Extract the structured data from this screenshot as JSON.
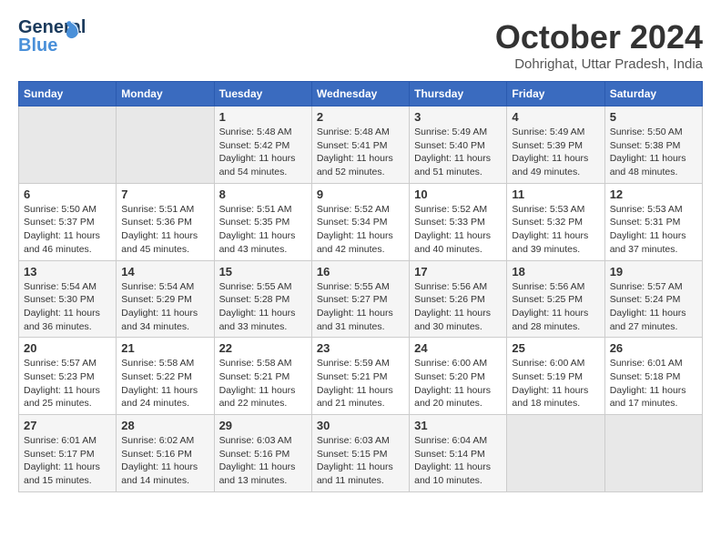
{
  "logo": {
    "line1": "General",
    "line2": "Blue"
  },
  "title": "October 2024",
  "subtitle": "Dohrighat, Uttar Pradesh, India",
  "days_header": [
    "Sunday",
    "Monday",
    "Tuesday",
    "Wednesday",
    "Thursday",
    "Friday",
    "Saturday"
  ],
  "weeks": [
    [
      {
        "day": "",
        "info": ""
      },
      {
        "day": "",
        "info": ""
      },
      {
        "day": "1",
        "info": "Sunrise: 5:48 AM\nSunset: 5:42 PM\nDaylight: 11 hours and 54 minutes."
      },
      {
        "day": "2",
        "info": "Sunrise: 5:48 AM\nSunset: 5:41 PM\nDaylight: 11 hours and 52 minutes."
      },
      {
        "day": "3",
        "info": "Sunrise: 5:49 AM\nSunset: 5:40 PM\nDaylight: 11 hours and 51 minutes."
      },
      {
        "day": "4",
        "info": "Sunrise: 5:49 AM\nSunset: 5:39 PM\nDaylight: 11 hours and 49 minutes."
      },
      {
        "day": "5",
        "info": "Sunrise: 5:50 AM\nSunset: 5:38 PM\nDaylight: 11 hours and 48 minutes."
      }
    ],
    [
      {
        "day": "6",
        "info": "Sunrise: 5:50 AM\nSunset: 5:37 PM\nDaylight: 11 hours and 46 minutes."
      },
      {
        "day": "7",
        "info": "Sunrise: 5:51 AM\nSunset: 5:36 PM\nDaylight: 11 hours and 45 minutes."
      },
      {
        "day": "8",
        "info": "Sunrise: 5:51 AM\nSunset: 5:35 PM\nDaylight: 11 hours and 43 minutes."
      },
      {
        "day": "9",
        "info": "Sunrise: 5:52 AM\nSunset: 5:34 PM\nDaylight: 11 hours and 42 minutes."
      },
      {
        "day": "10",
        "info": "Sunrise: 5:52 AM\nSunset: 5:33 PM\nDaylight: 11 hours and 40 minutes."
      },
      {
        "day": "11",
        "info": "Sunrise: 5:53 AM\nSunset: 5:32 PM\nDaylight: 11 hours and 39 minutes."
      },
      {
        "day": "12",
        "info": "Sunrise: 5:53 AM\nSunset: 5:31 PM\nDaylight: 11 hours and 37 minutes."
      }
    ],
    [
      {
        "day": "13",
        "info": "Sunrise: 5:54 AM\nSunset: 5:30 PM\nDaylight: 11 hours and 36 minutes."
      },
      {
        "day": "14",
        "info": "Sunrise: 5:54 AM\nSunset: 5:29 PM\nDaylight: 11 hours and 34 minutes."
      },
      {
        "day": "15",
        "info": "Sunrise: 5:55 AM\nSunset: 5:28 PM\nDaylight: 11 hours and 33 minutes."
      },
      {
        "day": "16",
        "info": "Sunrise: 5:55 AM\nSunset: 5:27 PM\nDaylight: 11 hours and 31 minutes."
      },
      {
        "day": "17",
        "info": "Sunrise: 5:56 AM\nSunset: 5:26 PM\nDaylight: 11 hours and 30 minutes."
      },
      {
        "day": "18",
        "info": "Sunrise: 5:56 AM\nSunset: 5:25 PM\nDaylight: 11 hours and 28 minutes."
      },
      {
        "day": "19",
        "info": "Sunrise: 5:57 AM\nSunset: 5:24 PM\nDaylight: 11 hours and 27 minutes."
      }
    ],
    [
      {
        "day": "20",
        "info": "Sunrise: 5:57 AM\nSunset: 5:23 PM\nDaylight: 11 hours and 25 minutes."
      },
      {
        "day": "21",
        "info": "Sunrise: 5:58 AM\nSunset: 5:22 PM\nDaylight: 11 hours and 24 minutes."
      },
      {
        "day": "22",
        "info": "Sunrise: 5:58 AM\nSunset: 5:21 PM\nDaylight: 11 hours and 22 minutes."
      },
      {
        "day": "23",
        "info": "Sunrise: 5:59 AM\nSunset: 5:21 PM\nDaylight: 11 hours and 21 minutes."
      },
      {
        "day": "24",
        "info": "Sunrise: 6:00 AM\nSunset: 5:20 PM\nDaylight: 11 hours and 20 minutes."
      },
      {
        "day": "25",
        "info": "Sunrise: 6:00 AM\nSunset: 5:19 PM\nDaylight: 11 hours and 18 minutes."
      },
      {
        "day": "26",
        "info": "Sunrise: 6:01 AM\nSunset: 5:18 PM\nDaylight: 11 hours and 17 minutes."
      }
    ],
    [
      {
        "day": "27",
        "info": "Sunrise: 6:01 AM\nSunset: 5:17 PM\nDaylight: 11 hours and 15 minutes."
      },
      {
        "day": "28",
        "info": "Sunrise: 6:02 AM\nSunset: 5:16 PM\nDaylight: 11 hours and 14 minutes."
      },
      {
        "day": "29",
        "info": "Sunrise: 6:03 AM\nSunset: 5:16 PM\nDaylight: 11 hours and 13 minutes."
      },
      {
        "day": "30",
        "info": "Sunrise: 6:03 AM\nSunset: 5:15 PM\nDaylight: 11 hours and 11 minutes."
      },
      {
        "day": "31",
        "info": "Sunrise: 6:04 AM\nSunset: 5:14 PM\nDaylight: 11 hours and 10 minutes."
      },
      {
        "day": "",
        "info": ""
      },
      {
        "day": "",
        "info": ""
      }
    ]
  ]
}
